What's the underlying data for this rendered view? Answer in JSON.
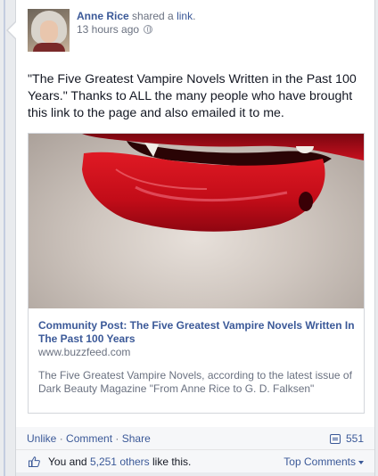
{
  "post": {
    "author": "Anne Rice",
    "action_verb": "shared a",
    "action_object": "link",
    "period": ".",
    "timestamp": "13 hours ago",
    "audience_icon": "globe-icon",
    "text": "\"The Five Greatest Vampire Novels Written in the Past 100 Years.\" Thanks to ALL the many people who have brought this link to the page and also emailed it to me."
  },
  "shared_link": {
    "title": "Community Post: The Five Greatest Vampire Novels Written In The Past 100 Years",
    "domain": "www.buzzfeed.com",
    "description": "The Five Greatest Vampire Novels, according to the latest issue of Dark Beauty Magazine \"From Anne Rice to G. D. Falksen\""
  },
  "actions": {
    "unlike": "Unlike",
    "separator": " · ",
    "comment": "Comment",
    "share": "Share",
    "share_count": "551",
    "share_count_icon": "comment-bubble-icon"
  },
  "likes": {
    "prefix": "You and ",
    "others": "5,251 others",
    "suffix": " like this.",
    "top_comments": "Top Comments",
    "icon": "thumbs-up-icon"
  },
  "colors": {
    "link_blue": "#3b5998",
    "lip_red": "#c8101e",
    "meta_gray": "#6a7180"
  }
}
